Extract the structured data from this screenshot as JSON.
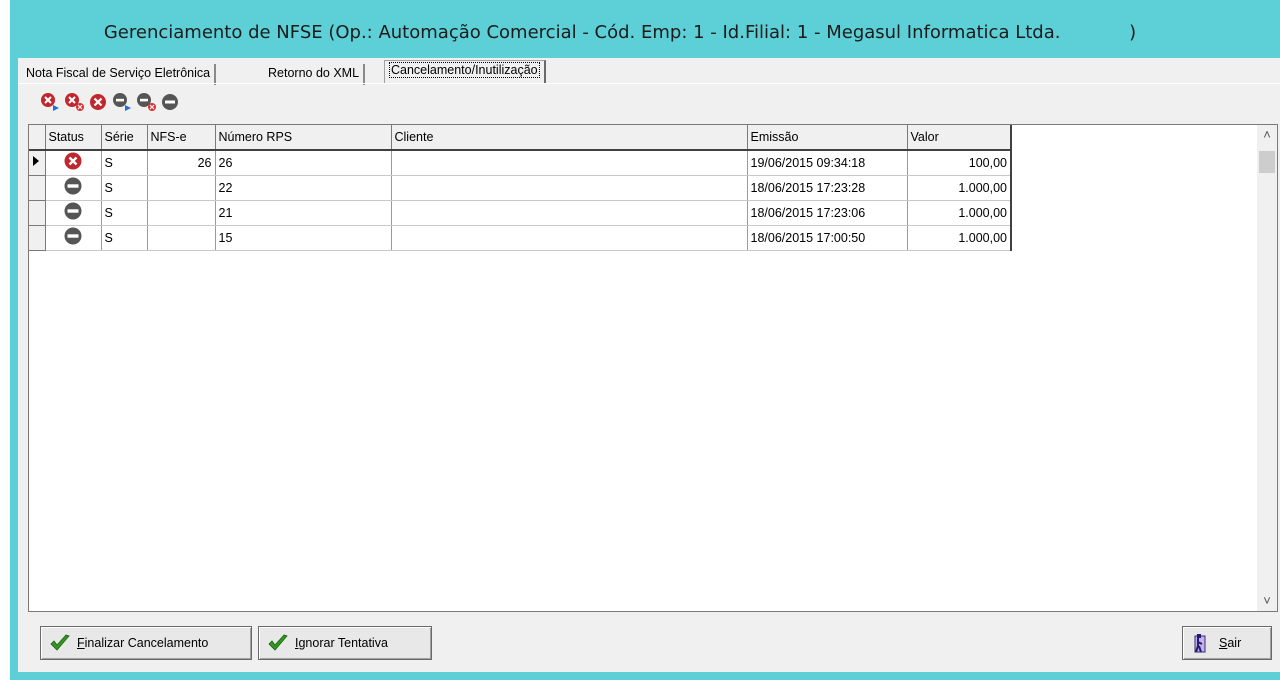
{
  "window": {
    "title": "Gerenciamento de NFSE (Op.: Automação Comercial - Cód. Emp: 1 - Id.Filial: 1 - Megasul Informatica Ltda.            )"
  },
  "tabs": [
    {
      "label": "Nota Fiscal de Serviço Eletrônica",
      "active": false
    },
    {
      "label": "Retorno do XML",
      "active": false
    },
    {
      "label": "Cancelamento/Inutilização",
      "active": true
    }
  ],
  "toolbar": {
    "icons": [
      "cancel-send-icon",
      "cancel-delete-icon",
      "cancel-icon",
      "inutilize-send-icon",
      "inutilize-delete-icon",
      "inutilize-icon"
    ]
  },
  "grid": {
    "columns": [
      "Status",
      "Série",
      "NFS-e",
      "Número RPS",
      "Cliente",
      "Emissão",
      "Valor"
    ],
    "rows": [
      {
        "status": "cancel-icon",
        "serie": "S",
        "nfse": "26",
        "rps": "26",
        "cliente": "",
        "emissao": "19/06/2015 09:34:18",
        "valor": "100,00",
        "current": true
      },
      {
        "status": "inutilize-icon",
        "serie": "S",
        "nfse": "",
        "rps": "22",
        "cliente": "",
        "emissao": "18/06/2015 17:23:28",
        "valor": "1.000,00",
        "current": false
      },
      {
        "status": "inutilize-icon",
        "serie": "S",
        "nfse": "",
        "rps": "21",
        "cliente": "",
        "emissao": "18/06/2015 17:23:06",
        "valor": "1.000,00",
        "current": false
      },
      {
        "status": "inutilize-icon",
        "serie": "S",
        "nfse": "",
        "rps": "15",
        "cliente": "",
        "emissao": "18/06/2015 17:00:50",
        "valor": "1.000,00",
        "current": false
      }
    ]
  },
  "buttons": {
    "finalize": {
      "mnemonic": "F",
      "rest": "inalizar Cancelamento"
    },
    "ignore": {
      "mnemonic": "I",
      "rest": "gnorar Tentativa"
    },
    "exit": {
      "mnemonic": "S",
      "rest": "air"
    }
  },
  "colors": {
    "titlebar": "#5dcfd6",
    "cancel_red": "#c0282d",
    "inutilize_gray": "#555555",
    "check_green": "#2f9a1e"
  }
}
